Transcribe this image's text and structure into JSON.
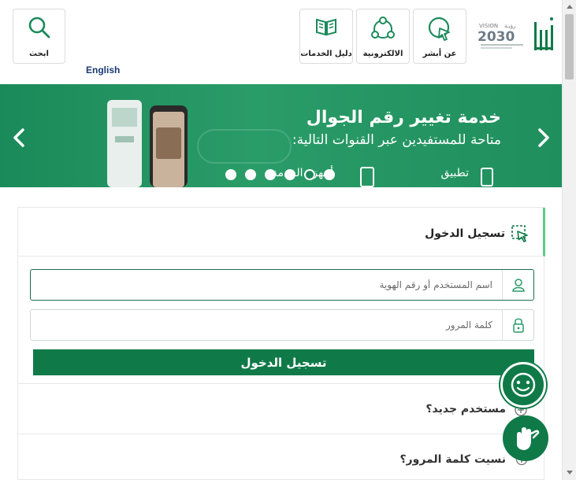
{
  "header": {
    "search_label": "ابحث",
    "tiles": [
      {
        "label": "عن أبشر",
        "icon": "pointer-circle-icon"
      },
      {
        "label": "الالكترونية",
        "icon": "network-icon"
      },
      {
        "label": "دليل الخدمات",
        "icon": "book-icon"
      }
    ],
    "language_link": "English",
    "logo": {
      "vision_label": "VISION",
      "vision_year": "2030"
    }
  },
  "banner": {
    "title": "خدمة تغيير رقم الجوال",
    "subtitle": "متاحة للمستفيدين عبر القنوات التالية:",
    "channel_app": "تطبيق",
    "channel_kiosk": "أجهزة الخدمة",
    "slide_count": 6,
    "active_slide": 5,
    "colors": {
      "background": "#1b8a5a"
    }
  },
  "login": {
    "title": "تسجيل الدخول",
    "username_placeholder": "اسم المستخدم أو رقم الهوية",
    "password_placeholder": "كلمة المرور",
    "submit_label": "تسجيل الدخول",
    "new_user_label": "مستخدم جديد؟",
    "forgot_password_label": "نسيت كلمة المرور؟"
  },
  "colors": {
    "primary": "#0f7a48",
    "accent_border": "#5fca8a",
    "link": "#1a3b73"
  }
}
